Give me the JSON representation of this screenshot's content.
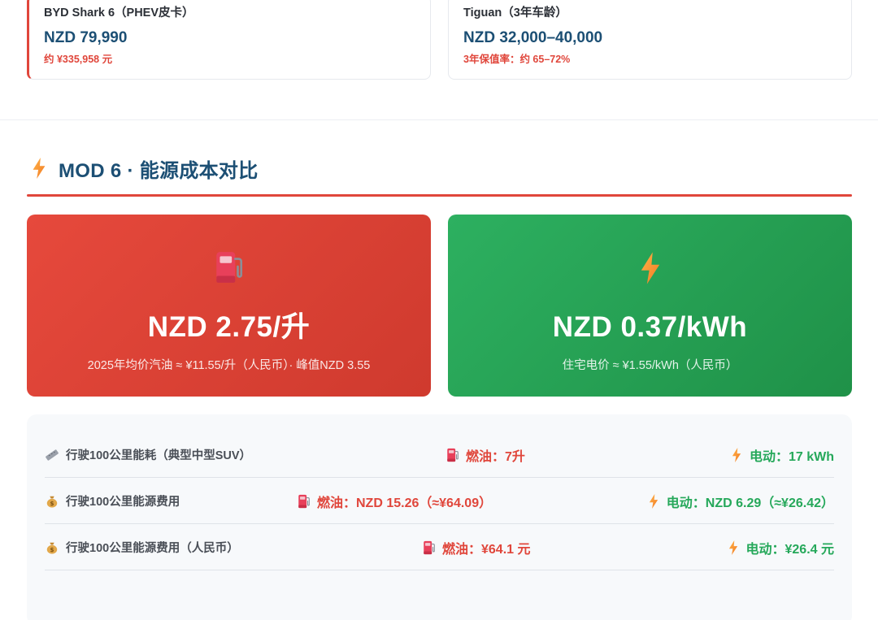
{
  "vehicles": [
    {
      "name": "BYD Shark 6（PHEV皮卡）",
      "price": "NZD 79,990",
      "sub": "约 ¥335,958 元"
    },
    {
      "name": "Tiguan（3年车龄）",
      "price": "NZD 32,000–40,000",
      "sub": "3年保值率：约 65–72%"
    }
  ],
  "section": {
    "title": "MOD 6 · 能源成本对比",
    "icon": "lightning-icon"
  },
  "fuel_card": {
    "icon": "fuel-pump-icon",
    "price": "NZD 2.75/升",
    "note": "2025年均价汽油 ≈ ¥11.55/升（人民币）· 峰值NZD 3.55"
  },
  "elec_card": {
    "icon": "lightning-icon",
    "price": "NZD 0.37/kWh",
    "note": "住宅电价 ≈ ¥1.55/kWh（人民币）"
  },
  "comparison": [
    {
      "icon": "ruler-icon",
      "label": "行驶100公里能耗（典型中型SUV）",
      "fuel": "燃油：7升",
      "elec": "电动：17 kWh"
    },
    {
      "icon": "money-bag-icon",
      "label": "行驶100公里能源费用",
      "fuel": "燃油：NZD 15.26（≈¥64.09）",
      "elec": "电动：NZD 6.29（≈¥26.42）"
    },
    {
      "icon": "money-bag-icon",
      "label": "行驶100公里能源费用（人民币）",
      "fuel": "燃油：¥64.1 元",
      "elec": "电动：¥26.4 元"
    }
  ],
  "colors": {
    "accent_red": "#e0463b",
    "accent_green": "#25a85a",
    "heading_blue": "#1c4f74"
  }
}
